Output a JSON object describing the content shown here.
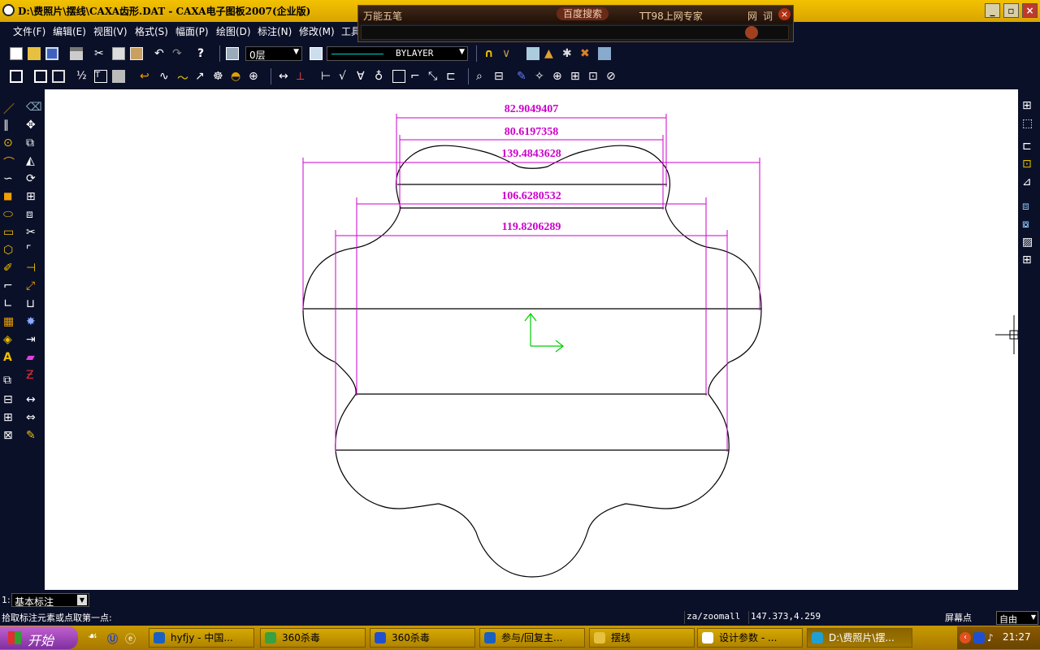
{
  "window": {
    "title": "D:\\费照片\\摆线\\CAXA齿形.DAT - CAXA电子图板2007(企业版)",
    "controls": [
      "minimize-icon",
      "restore-icon",
      "close-icon"
    ]
  },
  "menu": [
    "文件(F)",
    "编辑(E)",
    "视图(V)",
    "格式(S)",
    "幅面(P)",
    "绘图(D)",
    "标注(N)",
    "修改(M)",
    "工具"
  ],
  "ime": {
    "name": "万能五笔",
    "buttons": [
      "百度搜索",
      "TT98上网专家"
    ],
    "small_buttons": [
      "网",
      "词"
    ]
  },
  "properties": {
    "layer": "0层",
    "linetype_label": "BYLAYER"
  },
  "drawing": {
    "dimensions": [
      "82.9049407",
      "80.6197358",
      "139.4843628",
      "106.6280532",
      "119.8206289"
    ],
    "colors": {
      "dimension": "#cc00cc",
      "axis": "#00cc00",
      "line": "#000000"
    }
  },
  "command": {
    "line_number": "1:",
    "style_select": "基本标注",
    "prompt": "拾取标注元素或点取第一点:",
    "last_command": "za/zoomall",
    "coordinates": "147.373,4.259",
    "snap_label": "屏幕点",
    "snap_mode": "自由"
  },
  "taskbar": {
    "start_label": "开始",
    "tasks": [
      "hyfjy - 中国...",
      "360杀毒",
      "360杀毒",
      "参与/回复主...",
      "摆线",
      "设计参数 - ...",
      "D:\\费照片\\摆..."
    ],
    "clock": "21:27"
  }
}
